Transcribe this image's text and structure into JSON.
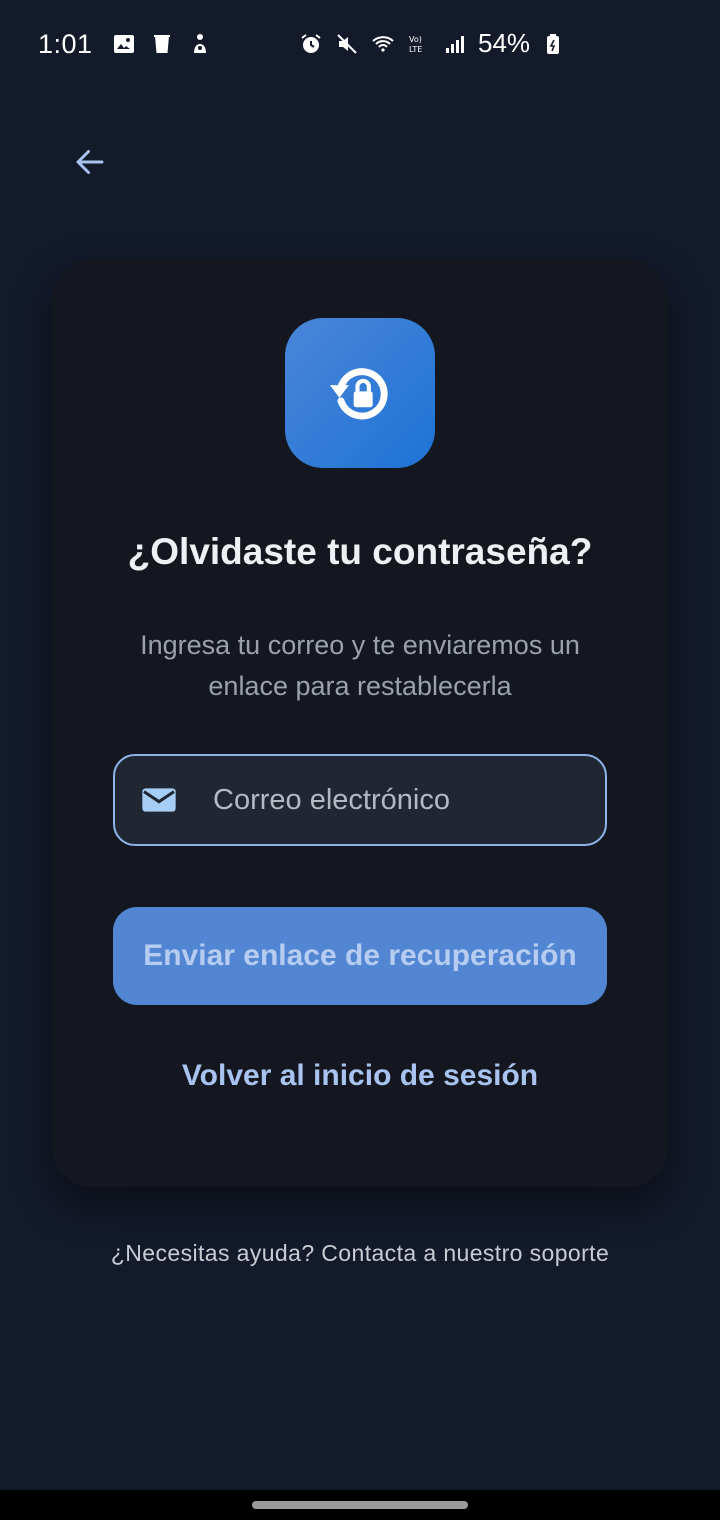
{
  "status_bar": {
    "time": "1:01",
    "battery": "54%",
    "icons_left": [
      "gallery-icon",
      "trash-icon",
      "accessibility-icon"
    ],
    "icons_right": [
      "alarm-icon",
      "mute-icon",
      "wifi-icon",
      "volte-icon",
      "signal-icon",
      "battery-icon"
    ]
  },
  "navigation": {
    "back_icon": "arrow-left-icon"
  },
  "card": {
    "icon": "lock-reset-icon",
    "title": "¿Olvidaste tu contraseña?",
    "subtitle": "Ingresa tu correo y te enviaremos un enlace para restablecerla",
    "email_field": {
      "icon": "mail-icon",
      "placeholder": "Correo electrónico",
      "value": ""
    },
    "send_button_label": "Enviar enlace de recuperación",
    "back_to_login_label": "Volver al inicio de sesión"
  },
  "footer": {
    "help_text": "¿Necesitas ayuda? Contacta a nuestro soporte"
  },
  "colors": {
    "background": "#131a2a",
    "card": "#141720",
    "accent": "#5286d2",
    "link": "#a9c3f0",
    "icon_gradient_start": "#4a86d8",
    "icon_gradient_end": "#1e73d6"
  }
}
